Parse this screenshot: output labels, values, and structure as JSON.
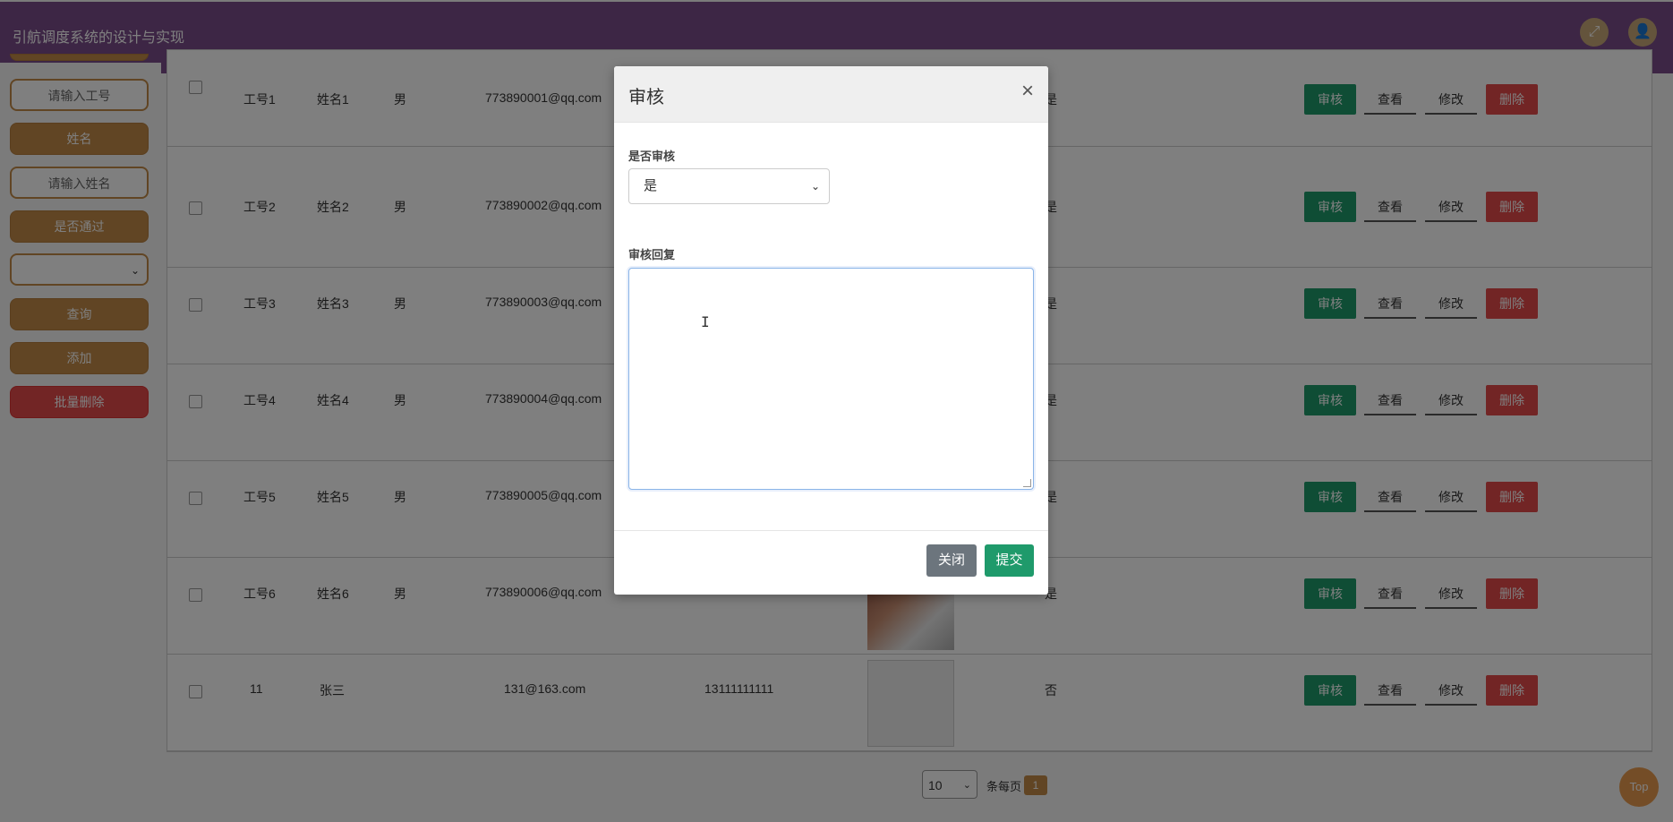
{
  "app": {
    "title": "引航调度系统的设计与实现"
  },
  "topbar": {
    "fullscreen_icon": "expand-icon",
    "user_icon": "user-icon"
  },
  "sidebar": {
    "gonghao_input_placeholder": "请输入工号",
    "xingming_label": "姓名",
    "xingming_input_placeholder": "请输入姓名",
    "shifoutongguo_label": "是否通过",
    "shifoutongguo_select_value": "",
    "query_button": "查询",
    "add_button": "添加",
    "batch_delete_button": "批量删除"
  },
  "table": {
    "rows": [
      {
        "gonghao": "工号1",
        "xingming": "姓名1",
        "xingbie": "男",
        "email": "773890001@qq.com",
        "phone": "",
        "status": "是"
      },
      {
        "gonghao": "工号2",
        "xingming": "姓名2",
        "xingbie": "男",
        "email": "773890002@qq.com",
        "phone": "",
        "status": "是"
      },
      {
        "gonghao": "工号3",
        "xingming": "姓名3",
        "xingbie": "男",
        "email": "773890003@qq.com",
        "phone": "",
        "status": "是"
      },
      {
        "gonghao": "工号4",
        "xingming": "姓名4",
        "xingbie": "男",
        "email": "773890004@qq.com",
        "phone": "",
        "status": "是"
      },
      {
        "gonghao": "工号5",
        "xingming": "姓名5",
        "xingbie": "男",
        "email": "773890005@qq.com",
        "phone": "",
        "status": "是"
      },
      {
        "gonghao": "工号6",
        "xingming": "姓名6",
        "xingbie": "男",
        "email": "773890006@qq.com",
        "phone": "",
        "status": "是"
      },
      {
        "gonghao": "11",
        "xingming": "张三",
        "xingbie": "",
        "email": "131@163.com",
        "phone": "13111111111",
        "status": "否"
      }
    ],
    "actions": {
      "audit": "审核",
      "view": "查看",
      "edit": "修改",
      "delete": "删除"
    }
  },
  "pagination": {
    "page_size": "10",
    "per_page_label": "条每页",
    "current_page": "1"
  },
  "top_button": "Top",
  "modal": {
    "title": "审核",
    "close_symbol": "×",
    "audit_label": "是否审核",
    "audit_value": "是",
    "reply_label": "审核回复",
    "reply_value": "",
    "close_button": "关闭",
    "submit_button": "提交"
  }
}
